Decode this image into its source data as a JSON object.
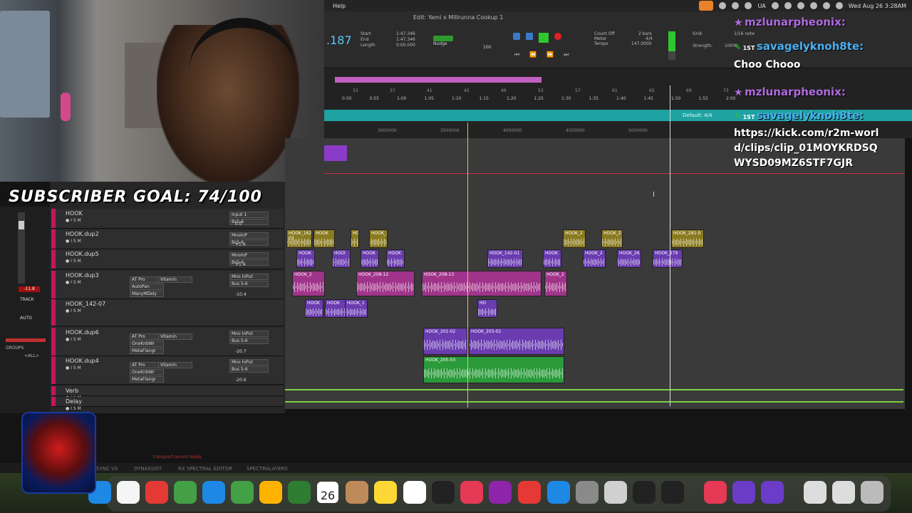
{
  "menubar": {
    "help": "Help",
    "kb": "UA",
    "date": "Wed Aug 26 3:28AM"
  },
  "window": {
    "title": "Edit: Yami x Millrunna Cookup 1"
  },
  "transport": {
    "counter": ".187",
    "start_label": "Start",
    "end_label": "End",
    "length_label": "Length",
    "start": "1:47.346",
    "end": "1:47.346",
    "length": "0:00.000",
    "nudge_label": "Nudge",
    "nudge_val": "100",
    "count_off": "Count Off",
    "meter_label": "Meter",
    "tempo_label": "Tempo",
    "bars": "2 bars",
    "meter": "4/4",
    "tempo": "147.0000",
    "grid_label": "Grid:",
    "grid_val": "1/16 note",
    "strength_label": "Strength:",
    "strength_val": "100%"
  },
  "ruler": {
    "default_meter": "Default: 4/4",
    "bars": [
      "33",
      "37",
      "41",
      "45",
      "49",
      "53",
      "57",
      "61",
      "65",
      "69",
      "73"
    ],
    "times": [
      "0:50",
      "0:55",
      "1:00",
      "1:05",
      "1:10",
      "1:15",
      "1:20",
      "1:25",
      "1:30",
      "1:35",
      "1:40",
      "1:45",
      "1:50",
      "1:55",
      "2:00"
    ],
    "samples": [
      "3000000",
      "3500000",
      "4000000",
      "4500000",
      "5000000"
    ]
  },
  "overlay": {
    "subscriber_goal": "SUBSCRIBER GOAL: 74/100"
  },
  "chat": [
    {
      "user": "mzlunarpheonix:",
      "badge": ""
    },
    {
      "user": "savagelyknoh8te:",
      "badge": "1ST",
      "msg": "Choo Chooo"
    },
    {
      "user": "mzlunarpheonix:",
      "badge": ""
    },
    {
      "user": "savagelyknoh8te:",
      "badge": "1ST",
      "msg": "https://kick.com/r2m-world/clips/clip_01MOYKRDSQWYSD09MZ6STF7GJR"
    }
  ],
  "tracks": [
    {
      "name": "HOOK",
      "insert": "Input 1",
      "bus": "Bs5-6",
      "vol": "0.0"
    },
    {
      "name": "HOOK.dup2",
      "insert": "MnoInP",
      "bus": "Bs5-6",
      "vol": "+1.4"
    },
    {
      "name": "HOOK.dup5",
      "insert": "MnoInP",
      "bus": "Bs5-6",
      "vol": "+1.4"
    },
    {
      "name": "HOOK.dup3",
      "plug1": "AT Pro",
      "plug2": "Vitamin",
      "plug3": "AutoPan",
      "plug4": "ManyMDely",
      "insert": "Mno InPut",
      "bus": "Bus 5-6",
      "vol": "-10.4"
    },
    {
      "name": "HOOK_142-07"
    },
    {
      "name": "HOOK.dup6",
      "plug1": "AT Pro",
      "plug2": "Vitamin",
      "plug3": "OneKnbWr",
      "plug4": "MetaFlangr",
      "insert": "Mno InPut",
      "bus": "Bus 5-6",
      "vol": "-20.7"
    },
    {
      "name": "HOOK.dup4",
      "plug1": "AT Pro",
      "plug2": "Vitamin",
      "plug3": "OneKnbWr",
      "plug4": "MetaFlangr",
      "insert": "Mno InPut",
      "bus": "Bus 5-6",
      "vol": "-20.6"
    },
    {
      "name": "Verb"
    },
    {
      "name": "Delay"
    }
  ],
  "clips": [
    {
      "lane": 1,
      "label": "HOOK_162-03",
      "c": "y"
    },
    {
      "lane": 1,
      "label": "HOOK",
      "c": "y"
    },
    {
      "lane": 1,
      "label": "HOOK",
      "c": "y"
    },
    {
      "lane": 1,
      "label": "HOOK_2",
      "c": "y"
    },
    {
      "lane": 1,
      "label": "HOOK_2",
      "c": "y"
    },
    {
      "lane": 1,
      "label": "HOOK_2",
      "c": "y"
    },
    {
      "lane": 1,
      "label": "HOOK_281-0",
      "c": "y"
    },
    {
      "lane": 2,
      "label": "HOOK",
      "c": "p"
    },
    {
      "lane": 2,
      "label": "HOOI",
      "c": "p"
    },
    {
      "lane": 2,
      "label": "HOOK",
      "c": "p"
    },
    {
      "lane": 2,
      "label": "HOOK",
      "c": "p"
    },
    {
      "lane": 2,
      "label": "HOOK_142-01",
      "c": "p"
    },
    {
      "lane": 2,
      "label": "HOOK",
      "c": "p"
    },
    {
      "lane": 2,
      "label": "HOOK_2",
      "c": "p"
    },
    {
      "lane": 2,
      "label": "HOOK_26",
      "c": "p"
    },
    {
      "lane": 2,
      "label": "HOOK_279",
      "c": "p"
    },
    {
      "lane": 3,
      "label": "HOOK_2",
      "c": "m"
    },
    {
      "lane": 3,
      "label": "HOOK_208-12",
      "c": "m"
    },
    {
      "lane": 3,
      "label": "HOOK_208-13",
      "c": "m"
    },
    {
      "lane": 3,
      "label": "HOOK_2",
      "c": "m"
    },
    {
      "lane": 4,
      "label": "HOOK",
      "c": "p"
    },
    {
      "lane": 4,
      "label": "HOOK",
      "c": "p"
    },
    {
      "lane": 4,
      "label": "HOOK_1",
      "c": "p"
    },
    {
      "lane": 4,
      "label": "HO",
      "c": "p"
    },
    {
      "lane": 5,
      "label": "HOOK_201-02",
      "c": "p"
    },
    {
      "lane": 5,
      "label": "HOOK_203-02",
      "c": "p"
    },
    {
      "lane": 6,
      "label": "HOOK_205-03",
      "c": "g"
    }
  ],
  "left": {
    "vol": "-11.8",
    "track": "TRACK",
    "auto": "AUTO",
    "groups": "GROUPS",
    "all": "<ALL>"
  },
  "status": {
    "text": "transport record ready",
    "tabs": [
      "SYNC VX",
      "DYNASSIST",
      "RX SPECTRAL EDITOR",
      "SPECTRALAYERS"
    ]
  },
  "dock": {
    "calendar_day": "26"
  },
  "colors": {
    "accent": "#5ac8f5",
    "tempo": "#1fa2a2",
    "chat_user1": "#b06ae0",
    "chat_user2": "#4ab0f0"
  }
}
